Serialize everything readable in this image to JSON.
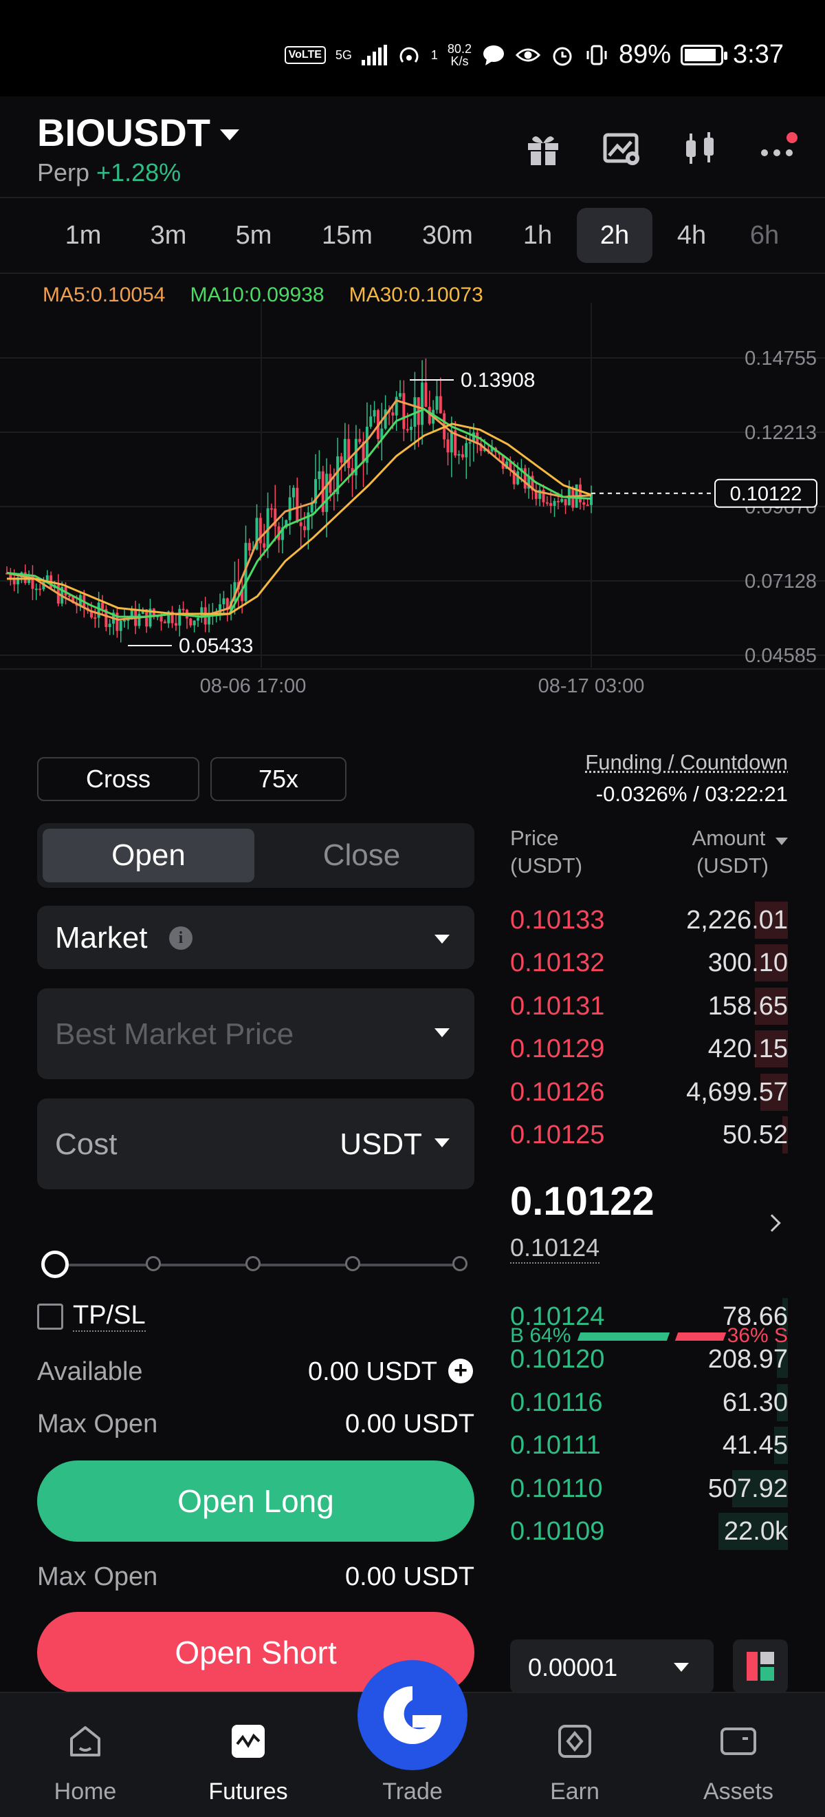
{
  "status_bar": {
    "volte": "VoLTE",
    "network": "5G",
    "hotspot_count": "1",
    "speed_value": "80.2",
    "speed_unit": "K/s",
    "battery": "89%",
    "time": "3:37"
  },
  "header": {
    "symbol": "BIOUSDT",
    "type": "Perp",
    "change": "+1.28%"
  },
  "timeframes": {
    "items": [
      "1m",
      "3m",
      "5m",
      "15m",
      "30m",
      "1h",
      "2h",
      "4h",
      "6h"
    ],
    "active": "2h"
  },
  "chart": {
    "ma5": "MA5:0.10054",
    "ma10": "MA10:0.09938",
    "ma30": "MA30:0.10073",
    "y_ticks": [
      "0.14755",
      "0.12213",
      "0.09670",
      "0.07128",
      "0.04585"
    ],
    "x_ticks": [
      "08-06 17:00",
      "08-17 03:00"
    ],
    "high_label": "0.13908",
    "low_label": "0.05433",
    "last_price": "0.10122",
    "colors": {
      "ma5": "#f0a050",
      "ma10": "#4cd964",
      "ma30": "#f5b942",
      "up": "#2ebd85",
      "down": "#f6465d"
    }
  },
  "chart_data": {
    "type": "line",
    "x_labels": [
      "08-06 17:00",
      "08-17 03:00"
    ],
    "ylim": [
      0.04585,
      0.14755
    ],
    "y_ticks": [
      0.14755,
      0.12213,
      0.0967,
      0.07128,
      0.04585
    ],
    "series": [
      {
        "name": "MA5",
        "values": [
          0.074,
          0.072,
          0.066,
          0.061,
          0.058,
          0.059,
          0.06,
          0.059,
          0.062,
          0.085,
          0.095,
          0.098,
          0.11,
          0.12,
          0.133,
          0.13,
          0.122,
          0.118,
          0.11,
          0.102,
          0.1,
          0.10054
        ]
      },
      {
        "name": "MA10",
        "values": [
          0.074,
          0.073,
          0.068,
          0.063,
          0.059,
          0.059,
          0.06,
          0.059,
          0.06,
          0.078,
          0.09,
          0.094,
          0.104,
          0.114,
          0.126,
          0.13,
          0.124,
          0.12,
          0.113,
          0.105,
          0.1,
          0.09938
        ]
      },
      {
        "name": "MA30",
        "values": [
          0.072,
          0.072,
          0.07,
          0.066,
          0.062,
          0.061,
          0.06,
          0.06,
          0.06,
          0.066,
          0.078,
          0.086,
          0.095,
          0.104,
          0.114,
          0.121,
          0.125,
          0.123,
          0.118,
          0.111,
          0.104,
          0.10073
        ]
      }
    ],
    "annotations": {
      "high": 0.13908,
      "low": 0.05433,
      "last": 0.10122
    }
  },
  "trade": {
    "margin_mode": "Cross",
    "leverage": "75x",
    "funding_label": "Funding / Countdown",
    "funding_value": "-0.0326% / 03:22:21",
    "open_tab": "Open",
    "close_tab": "Close",
    "order_type": "Market",
    "price_placeholder": "Best Market Price",
    "cost_label": "Cost",
    "cost_unit": "USDT",
    "tpsl_label": "TP/SL",
    "available_label": "Available",
    "available_value": "0.00 USDT",
    "max_open_label": "Max Open",
    "max_open_long": "0.00 USDT",
    "max_open_short": "0.00 USDT",
    "open_long": "Open Long",
    "open_short": "Open Short",
    "slider_percent": 0
  },
  "orderbook": {
    "price_header": "Price",
    "price_unit": "(USDT)",
    "amount_header": "Amount",
    "amount_unit": "(USDT)",
    "asks": [
      {
        "price": "0.10133",
        "amount": "2,226.01",
        "depth": 0.12
      },
      {
        "price": "0.10132",
        "amount": "300.10",
        "depth": 0.12
      },
      {
        "price": "0.10131",
        "amount": "158.65",
        "depth": 0.12
      },
      {
        "price": "0.10129",
        "amount": "420.15",
        "depth": 0.12
      },
      {
        "price": "0.10126",
        "amount": "4,699.57",
        "depth": 0.1
      },
      {
        "price": "0.10125",
        "amount": "50.52",
        "depth": 0.02
      }
    ],
    "mid_price": "0.10122",
    "mark_price": "0.10124",
    "bids": [
      {
        "price": "0.10124",
        "amount": "78.66",
        "depth": 0.02
      },
      {
        "price": "0.10120",
        "amount": "208.97",
        "depth": 0.04
      },
      {
        "price": "0.10116",
        "amount": "61.30",
        "depth": 0.04
      },
      {
        "price": "0.10111",
        "amount": "41.45",
        "depth": 0.05
      },
      {
        "price": "0.10110",
        "amount": "507.92",
        "depth": 0.2
      },
      {
        "price": "0.10109",
        "amount": "22.0k",
        "depth": 0.25
      }
    ],
    "buy_ratio": "64%",
    "sell_ratio": "36%",
    "buy_prefix": "B",
    "sell_suffix": "S",
    "buy_fraction": 0.64,
    "step": "0.00001"
  },
  "nav": {
    "home": "Home",
    "futures": "Futures",
    "trade": "Trade",
    "earn": "Earn",
    "assets": "Assets"
  }
}
